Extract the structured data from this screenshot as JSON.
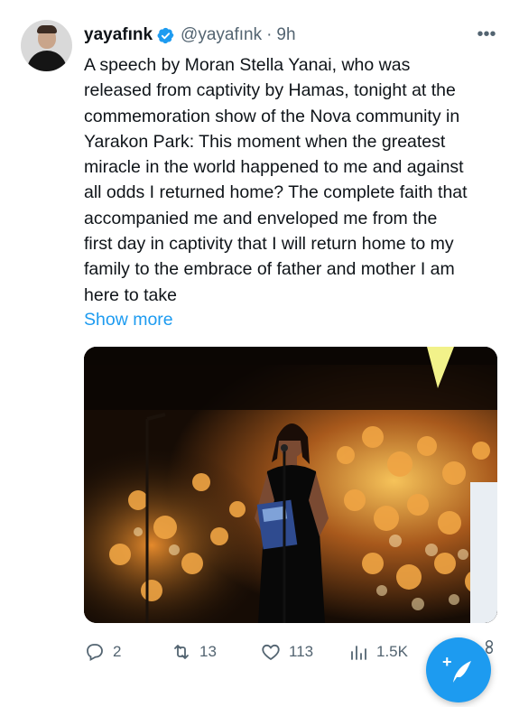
{
  "tweet": {
    "author_name": "yayafınk",
    "handle": "@yayafınk",
    "separator": "·",
    "time": "9h",
    "text_lines": [
      "A speech by Moran Stella Yanai, who was",
      "released from captivity by Hamas, tonight at the",
      "commemoration show of the Nova community in",
      "Yarakon Park: This moment when the greatest",
      "miracle in the world happened to me and against",
      "all odds I returned home? The complete faith that",
      "accompanied me and enveloped me from the",
      "first day in captivity that I will return home to my",
      "family to the embrace of father and mother I am",
      "here to take"
    ],
    "show_more": "Show more",
    "media": {
      "description_icon": "photo-stage-speech"
    },
    "actions": {
      "replies": "2",
      "retweets": "13",
      "likes": "113",
      "views": "1.5K"
    }
  },
  "colors": {
    "accent": "#1d9bf0",
    "text": "#0f1419",
    "muted": "#536471"
  }
}
